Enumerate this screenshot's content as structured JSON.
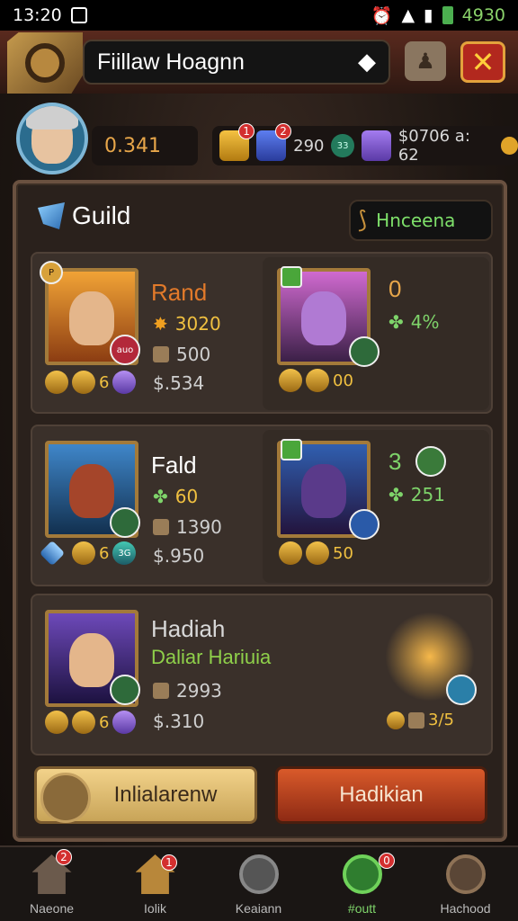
{
  "status_bar": {
    "time": "13:20",
    "battery": "4930"
  },
  "header": {
    "title": "Fiillaw Hoagnn",
    "notif_dot": ""
  },
  "player": {
    "gold": "0.341"
  },
  "resources": {
    "r1_badge": "1",
    "r2_badge": "2",
    "r2_value": "290",
    "gem_label": "33",
    "r3_value": "$0706 a: 62"
  },
  "panel": {
    "title": "Guild",
    "tag": "Hnceena"
  },
  "members": [
    {
      "name": "Rand",
      "name_color": "#e27a2a",
      "badge": "P",
      "portrait_badge": "auo",
      "stat1": "3020",
      "stat2": "500",
      "stat3": "$.534",
      "medal_count": "6",
      "mount_level": "0",
      "mount_stat": "4%",
      "mount_medals": "00"
    },
    {
      "name": "Fald",
      "name_color": "#ffffff",
      "stat1": "60",
      "stat2": "1390",
      "stat3": "$.950",
      "medal_count": "6",
      "medal_badge": "3G",
      "mount_level": "3",
      "mount_stat": "251",
      "mount_medals": "50"
    },
    {
      "name": "Hadiah",
      "subtitle": "Daliar Hariuia",
      "name_color": "#d8d8d8",
      "stat2": "2993",
      "stat3": "$.310",
      "medal_count": "6",
      "mount_stat": "3/5"
    }
  ],
  "buttons": {
    "left": "Inlialarenw",
    "right": "Hadikian"
  },
  "nav": [
    {
      "label": "Naeone",
      "badge": "2",
      "icon": "home-icon"
    },
    {
      "label": "Iolik",
      "badge": "1",
      "icon": "hut-icon"
    },
    {
      "label": "Keaiann",
      "badge": "",
      "icon": "crossed-swords-icon"
    },
    {
      "label": "#outt",
      "badge": "0",
      "icon": "refresh-icon"
    },
    {
      "label": "Hachood",
      "badge": "",
      "icon": "seal-icon"
    }
  ],
  "colors": {
    "accent_green": "#7ed36a",
    "gold": "#e7a64a",
    "panel_bg": "#2a211c"
  }
}
